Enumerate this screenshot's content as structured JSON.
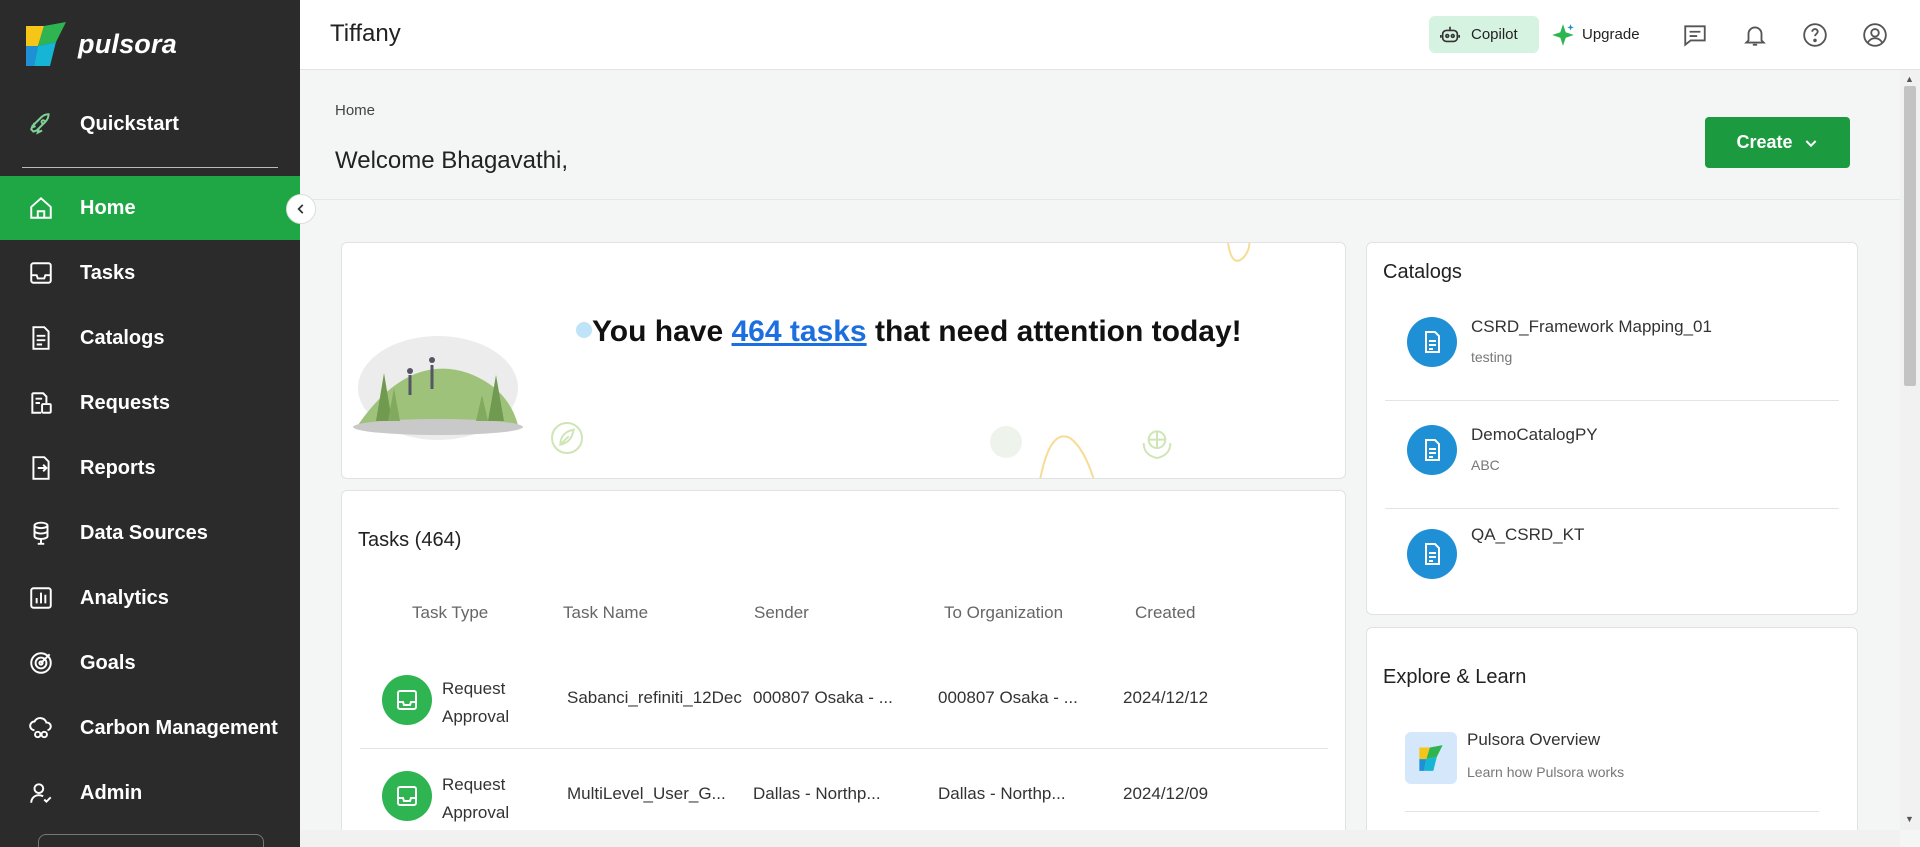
{
  "app": {
    "brand": "pulsora"
  },
  "sidebar": {
    "quickstart": {
      "label": "Quickstart",
      "icon": "rocket-icon"
    },
    "items": [
      {
        "label": "Home",
        "icon": "home-icon",
        "active": true
      },
      {
        "label": "Tasks",
        "icon": "inbox-icon"
      },
      {
        "label": "Catalogs",
        "icon": "document-icon"
      },
      {
        "label": "Requests",
        "icon": "requests-icon"
      },
      {
        "label": "Reports",
        "icon": "reports-icon"
      },
      {
        "label": "Data Sources",
        "icon": "database-icon"
      },
      {
        "label": "Analytics",
        "icon": "bar-chart-icon"
      },
      {
        "label": "Goals",
        "icon": "target-icon"
      },
      {
        "label": "Carbon Management",
        "icon": "cloud-co2-icon"
      },
      {
        "label": "Admin",
        "icon": "user-check-icon"
      }
    ],
    "accent": "#1fa645"
  },
  "header": {
    "org": "Tiffany",
    "copilot_label": "Copilot",
    "upgrade_label": "Upgrade"
  },
  "page": {
    "breadcrumb": "Home",
    "welcome": "Welcome Bhagavathi,",
    "create_label": "Create"
  },
  "banner": {
    "prefix": "You have",
    "link": "464 tasks",
    "suffix": "that need attention today!"
  },
  "tasks": {
    "title": "Tasks (464)",
    "columns": [
      "Task Type",
      "Task Name",
      "Sender",
      "To Organization",
      "Created"
    ],
    "rows": [
      {
        "type_line1": "Request",
        "type_line2": "Approval",
        "name": "Sabanci_refiniti_12Dec",
        "sender": "000807 Osaka - ...",
        "org": "000807 Osaka - ...",
        "created": "2024/12/12"
      },
      {
        "type_line1": "Request",
        "type_line2": "Approval",
        "name": "MultiLevel_User_G...",
        "sender": "Dallas - Northp...",
        "org": "Dallas - Northp...",
        "created": "2024/12/09"
      }
    ]
  },
  "catalogs": {
    "title": "Catalogs",
    "items": [
      {
        "name": "CSRD_Framework Mapping_01",
        "sub": "testing"
      },
      {
        "name": "DemoCatalogPY",
        "sub": "ABC"
      },
      {
        "name": "QA_CSRD_KT",
        "sub": ""
      }
    ]
  },
  "explore": {
    "title": "Explore & Learn",
    "items": [
      {
        "name": "Pulsora Overview",
        "sub": "Learn how Pulsora works"
      }
    ]
  }
}
